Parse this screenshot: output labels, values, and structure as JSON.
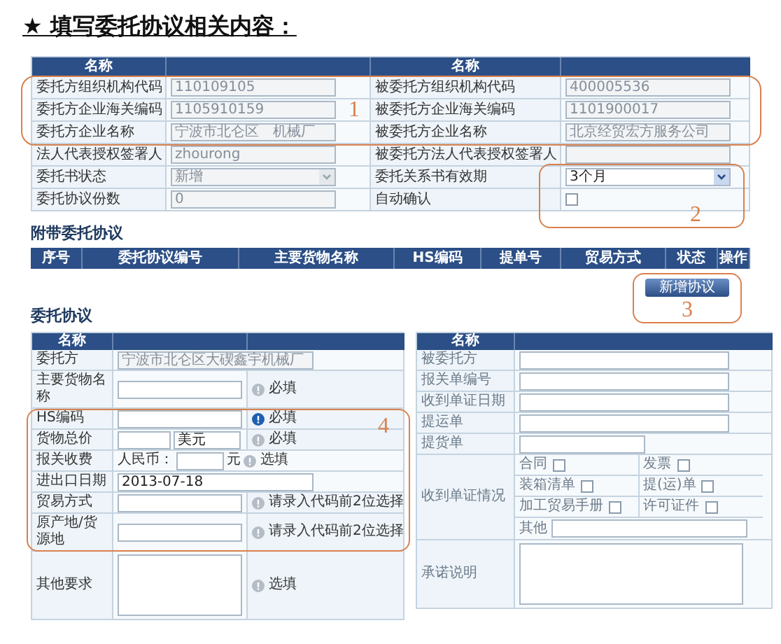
{
  "title": "★ 填写委托协议相关内容：",
  "main_table": {
    "headers": [
      "名称",
      "名称"
    ],
    "rows": [
      {
        "left": {
          "label": "委托方组织机构代码",
          "field": {
            "kind": "input",
            "value": "110109105",
            "disabled": true
          }
        },
        "right": {
          "label": "被委托方组织机构代码",
          "field": {
            "kind": "input",
            "value": "400005536",
            "disabled": true
          }
        }
      },
      {
        "left": {
          "label": "委托方企业海关编码",
          "field": {
            "kind": "input",
            "value": "1105910159",
            "disabled": true
          }
        },
        "right": {
          "label": "被委托方企业海关编码",
          "field": {
            "kind": "input",
            "value": "1101900017",
            "disabled": true
          }
        }
      },
      {
        "left": {
          "label": "委托方企业名称",
          "field": {
            "kind": "input",
            "value": "宁波市北仑区　机械厂",
            "disabled": true
          }
        },
        "right": {
          "label": "被委托方企业名称",
          "field": {
            "kind": "input",
            "value": "北京经贸宏方服务公司",
            "disabled": true
          }
        }
      },
      {
        "left": {
          "label": "法人代表授权签署人",
          "field": {
            "kind": "input",
            "value": "zhourong",
            "disabled": true
          }
        },
        "right": {
          "label": "被委托方法人代表授权签署人",
          "field": {
            "kind": "input",
            "disabled": true
          }
        }
      },
      {
        "left": {
          "label": "委托书状态",
          "field": {
            "kind": "select",
            "value": "新增",
            "disabled": true
          }
        },
        "right": {
          "label": "委托关系书有效期",
          "field": {
            "kind": "select",
            "value": "3个月",
            "disabled": false
          }
        }
      },
      {
        "left": {
          "label": "委托协议份数",
          "field": {
            "kind": "input",
            "value": "0",
            "disabled": true
          }
        },
        "right": {
          "label": "自动确认",
          "field": {
            "kind": "checkbox",
            "checked": false
          }
        }
      }
    ]
  },
  "attachments": {
    "title": "附带委托协议",
    "columns": [
      "序号",
      "委托协议编号",
      "主要货物名称",
      "HS编码",
      "提单号",
      "贸易方式",
      "状态",
      "操作"
    ],
    "button": "新增协议"
  },
  "agreement": {
    "title": "委托协议",
    "left": {
      "header": "名称",
      "rows": [
        {
          "kind": "input",
          "label": "委托方",
          "value": "宁波市北仑区大碶鑫宇机械厂",
          "disabled": true
        },
        {
          "kind": "input",
          "label": "主要货物名称",
          "disabled": false,
          "note": {
            "text": "必填",
            "active": false
          }
        },
        {
          "kind": "input",
          "label": "HS编码",
          "disabled": false,
          "note": {
            "text": "必填",
            "active": true
          }
        },
        {
          "kind": "price",
          "label": "货物总价",
          "currency": "美元",
          "note": {
            "text": "必填",
            "active": false
          }
        },
        {
          "kind": "fee",
          "label": "报关收费",
          "prefix": "人民币：",
          "unit": "元",
          "note": {
            "text": "选填",
            "active": false
          }
        },
        {
          "kind": "input",
          "label": "进出口日期",
          "value": "2013-07-18",
          "disabled": false
        },
        {
          "kind": "input",
          "label": "贸易方式",
          "disabled": false,
          "note": {
            "text": "请录入代码前2位选择",
            "active": false
          }
        },
        {
          "kind": "input",
          "label": "原产地/货源地",
          "disabled": false,
          "note": {
            "text": "请录入代码前2位选择",
            "active": false
          }
        },
        {
          "kind": "textarea",
          "label": "其他要求",
          "note": {
            "text": "选填",
            "active": false
          }
        }
      ]
    },
    "right": {
      "header": "名称",
      "rows": [
        {
          "kind": "input",
          "label": "被委托方"
        },
        {
          "kind": "input",
          "label": "报关单编号"
        },
        {
          "kind": "input",
          "label": "收到单证日期"
        },
        {
          "kind": "input",
          "label": "提运单"
        },
        {
          "kind": "short_input",
          "label": "提货单"
        },
        {
          "kind": "documents",
          "label": "收到单证情况",
          "checks": [
            {
              "label": "合同",
              "checked": false
            },
            {
              "label": "发票",
              "checked": false
            },
            {
              "label": "装箱清单",
              "checked": false
            },
            {
              "label": "提(运)单",
              "checked": false
            },
            {
              "label": "加工贸易手册",
              "checked": false
            },
            {
              "label": "许可证件",
              "checked": false
            }
          ],
          "other_label": "其他"
        },
        {
          "kind": "textarea",
          "label": "承诺说明"
        }
      ]
    }
  },
  "annotations": [
    "1",
    "2",
    "3",
    "4"
  ]
}
